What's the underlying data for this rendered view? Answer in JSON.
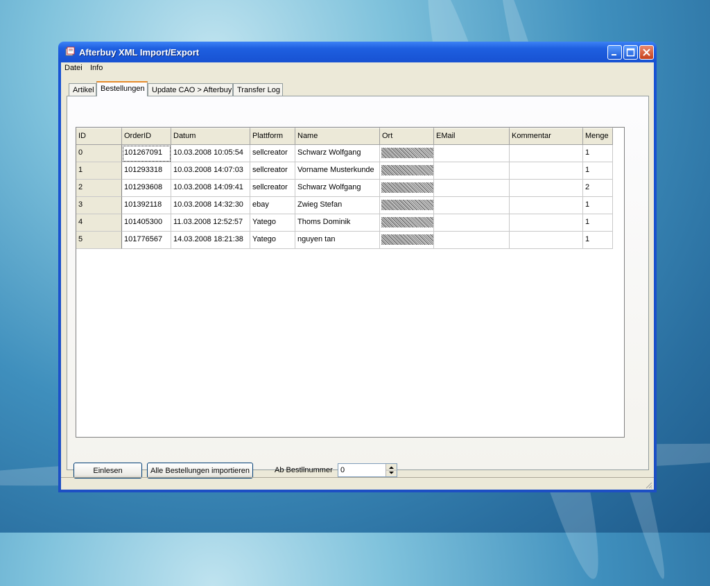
{
  "window": {
    "title": "Afterbuy XML Import/Export"
  },
  "menu": [
    "Datei",
    "Info"
  ],
  "tabs": [
    "Artikel",
    "Bestellungen",
    "Update CAO > Afterbuy",
    "Transfer Log"
  ],
  "active_tab": 1,
  "table": {
    "columns": [
      "ID",
      "OrderID",
      "Datum",
      "Plattform",
      "Name",
      "Ort",
      "EMail",
      "Kommentar",
      "Menge"
    ],
    "rows": [
      [
        "0",
        "101267091",
        "10.03.2008 10:05:54",
        "sellcreator",
        "Schwarz Wolfgang",
        "",
        "",
        "",
        "1"
      ],
      [
        "1",
        "101293318",
        "10.03.2008 14:07:03",
        "sellcreator",
        "Vorname Musterkunde",
        "",
        "",
        "",
        "1"
      ],
      [
        "2",
        "101293608",
        "10.03.2008 14:09:41",
        "sellcreator",
        "Schwarz Wolfgang",
        "",
        "",
        "",
        "2"
      ],
      [
        "3",
        "101392118",
        "10.03.2008 14:32:30",
        "ebay",
        "Zwieg Stefan",
        "",
        "",
        "",
        "1"
      ],
      [
        "4",
        "101405300",
        "11.03.2008 12:52:57",
        "Yatego",
        "Thoms Dominik",
        "",
        "",
        "",
        "1"
      ],
      [
        "5",
        "101776567",
        "14.03.2008 18:21:38",
        "Yatego",
        "nguyen tan",
        "",
        "",
        "",
        "1"
      ]
    ]
  },
  "buttons": {
    "einlesen": "Einlesen",
    "import_all": "Alle Bestellungen importieren"
  },
  "ab_label": "Ab Bestllnummer",
  "ab_value": "0"
}
